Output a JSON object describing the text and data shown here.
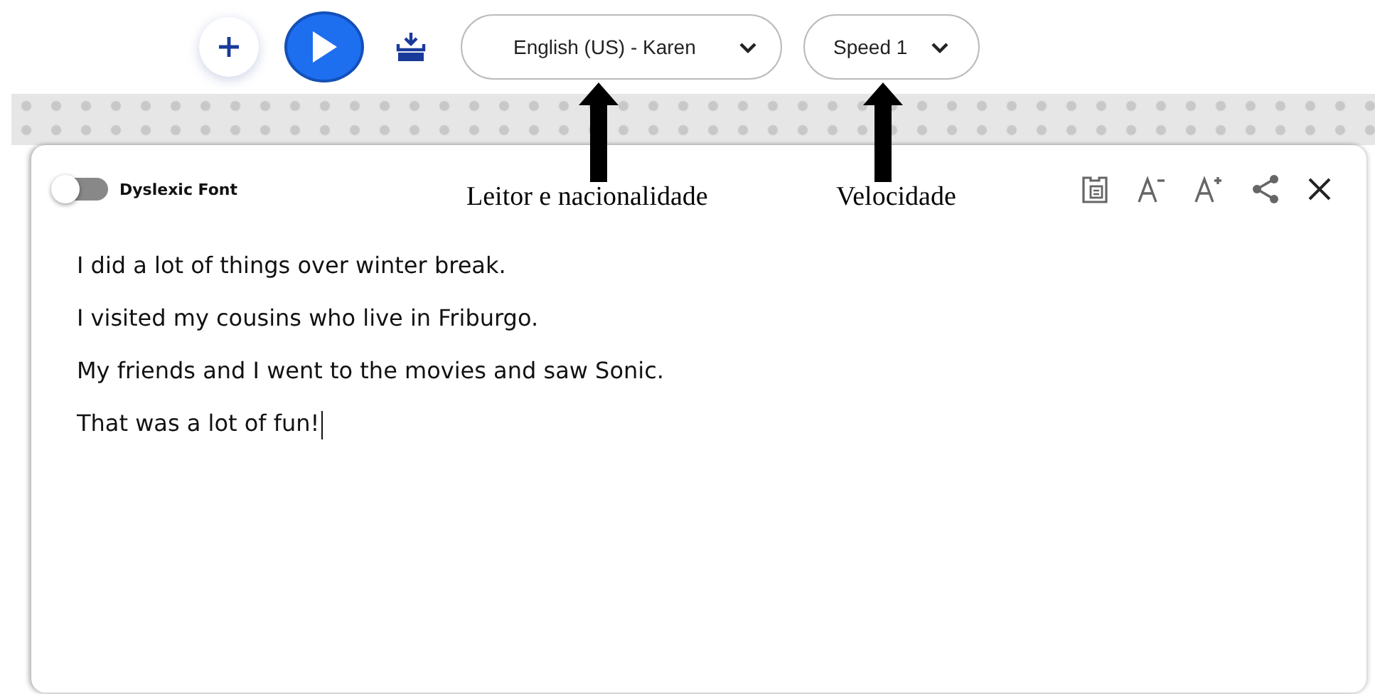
{
  "toolbar": {
    "voice": {
      "value": "English (US) - Karen"
    },
    "speed": {
      "value": "Speed 1"
    }
  },
  "dyslexic_font": {
    "label": "Dyslexic Font",
    "on": false
  },
  "annotations": [
    {
      "label": "Leitor e nacionalidade"
    },
    {
      "label": "Velocidade"
    }
  ],
  "text_lines": [
    "I did a lot of things over winter break.",
    "I visited my cousins who live in Friburgo.",
    "My friends and I went to the movies and saw Sonic.",
    "That was a lot of fun!"
  ]
}
